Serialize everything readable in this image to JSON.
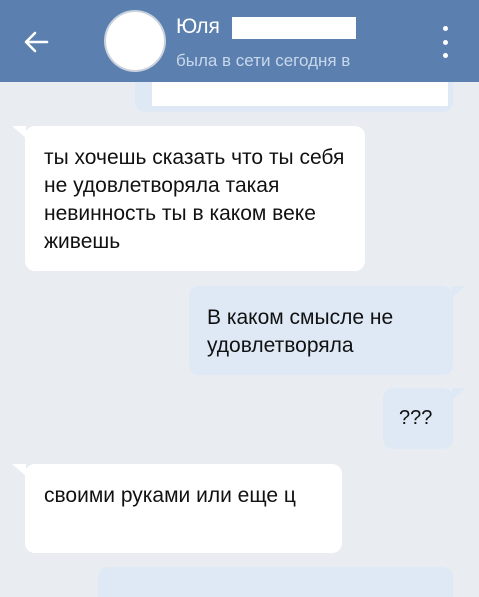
{
  "header": {
    "contact_name": "Юля",
    "status_text": "была в сети сегодня в"
  },
  "messages": [
    {
      "direction": "incoming",
      "text": "ты хочешь сказать что ты себя не удовлетворяла такая невинность ты в каком веке живешь"
    },
    {
      "direction": "outgoing",
      "text": "В каком смысле не удовлетворяла"
    },
    {
      "direction": "outgoing",
      "text": "???"
    },
    {
      "direction": "incoming",
      "text": "своими руками или еще ц"
    }
  ],
  "icons": {
    "back": "arrow-left-icon",
    "menu": "more-vertical-icon"
  },
  "colors": {
    "header": "#5b80b0",
    "background": "#e9edf2",
    "incoming_bubble": "#ffffff",
    "outgoing_bubble": "#dfe9f6"
  }
}
